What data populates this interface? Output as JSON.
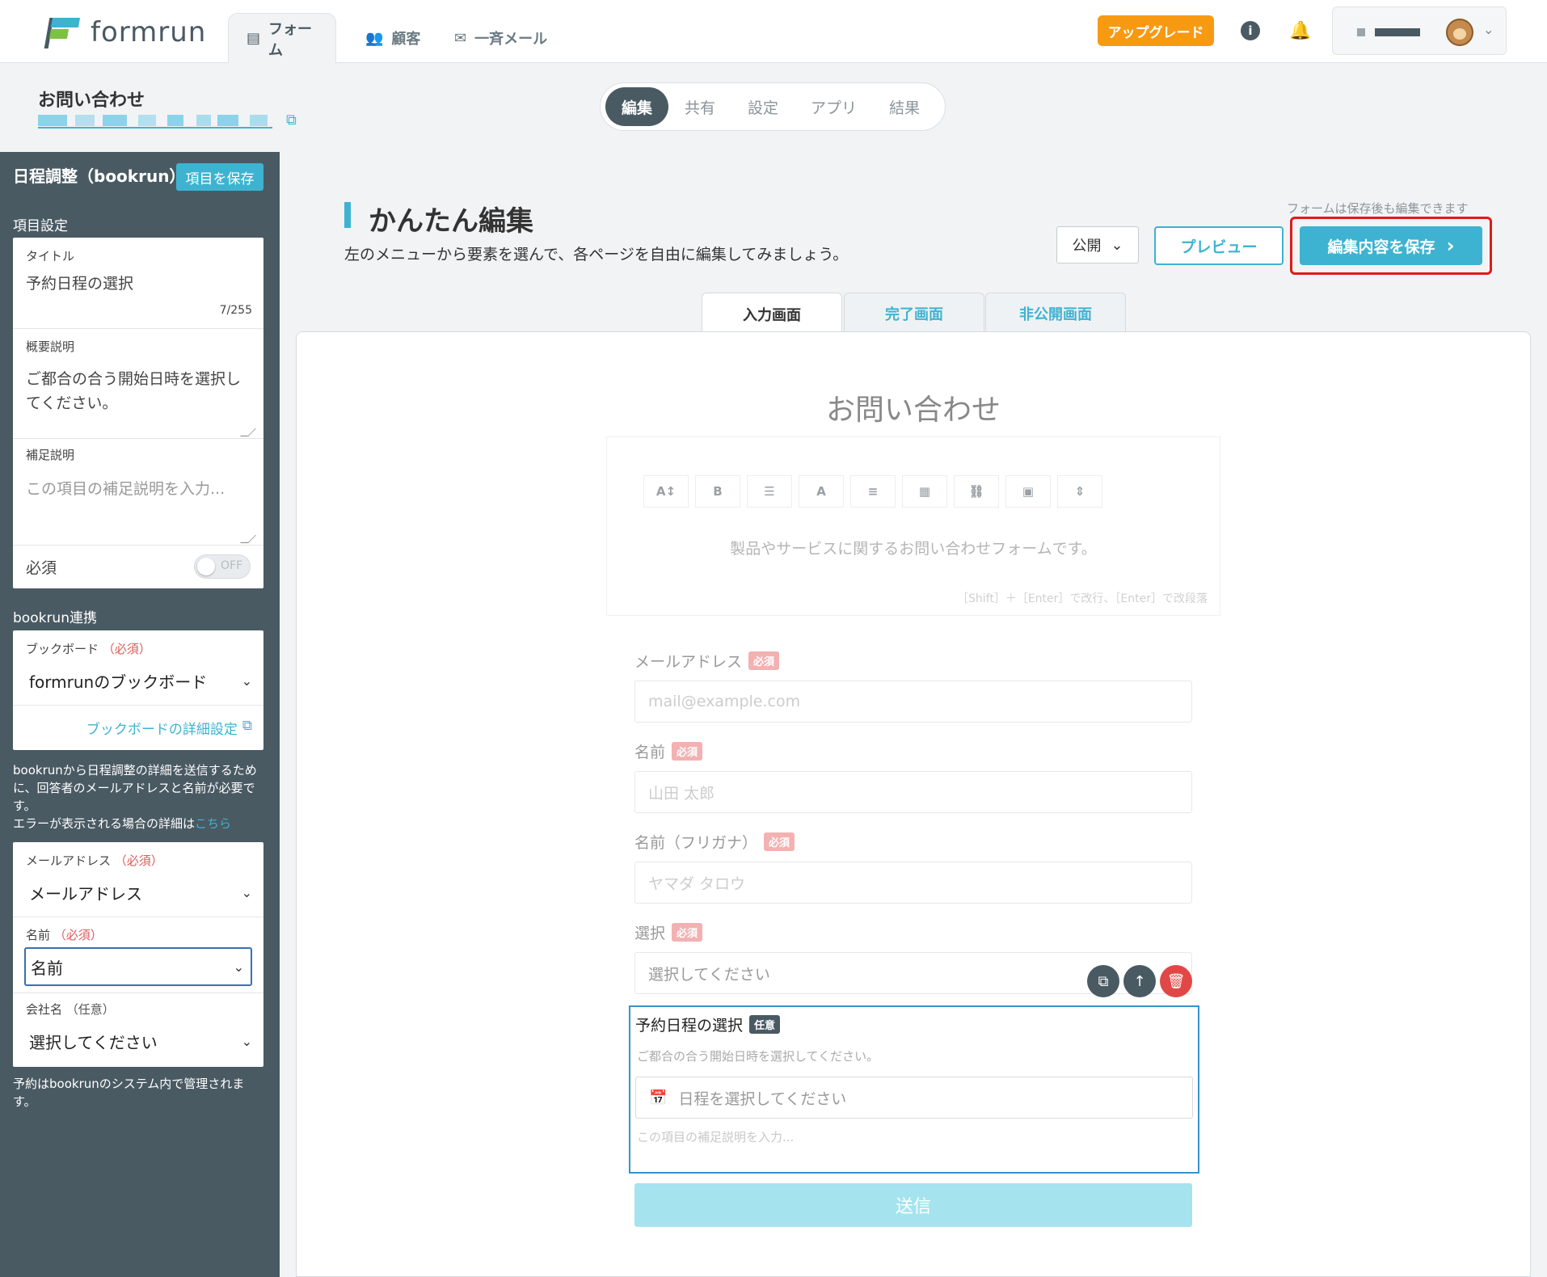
{
  "app": {
    "logo_text": "formrun",
    "nav": [
      {
        "icon": "form-icon",
        "label": "フォーム"
      },
      {
        "icon": "customers-icon",
        "label": "顧客"
      },
      {
        "icon": "mail-icon",
        "label": "一斉メール"
      }
    ],
    "upgrade_label": "アップグレード",
    "info_glyph": "i",
    "bell_glyph": "🔔",
    "account_chevron": "⌄"
  },
  "page": {
    "form_title": "お問い合わせ",
    "external_link_glyph": "⧉",
    "subtabs": [
      "編集",
      "共有",
      "設定",
      "アプリ",
      "結果"
    ]
  },
  "sidebar": {
    "title": "日程調整（bookrun）",
    "save_label": "項目を保存",
    "section_item": "項目設定",
    "title_label": "タイトル",
    "title_value": "予約日程の選択",
    "title_counter": "7/255",
    "summary_label": "概要説明",
    "summary_value": "ご都合の合う開始日時を選択してください。",
    "supplement_label": "補足説明",
    "supplement_placeholder": "この項目の補足説明を入力...",
    "required_label": "必須",
    "required_toggle": "OFF",
    "section_bookrun": "bookrun連携",
    "bookboard_label": "ブックボード",
    "bookboard_req": "（必須）",
    "bookboard_value": "formrunのブックボード",
    "bookboard_link": "ブックボードの詳細設定",
    "note1": "bookrunから日程調整の詳細を送信するために、回答者のメールアドレスと名前が必要です。",
    "note2_prefix": "エラーが表示される場合の詳細は",
    "note2_link": "こちら",
    "email_label": "メールアドレス",
    "email_req": "（必須）",
    "email_value": "メールアドレス",
    "name_label": "名前",
    "name_req": "（必須）",
    "name_value": "名前",
    "company_label": "会社名",
    "company_opt": "（任意）",
    "company_value": "選択してください",
    "footer_note": "予約はbookrunのシステム内で管理されます。",
    "chevron": "⌄"
  },
  "main": {
    "heading": "かんたん編集",
    "subheading": "左のメニューから要素を選んで、各ページを自由に編集してみましょう。",
    "save_hint": "フォームは保存後も編集できます",
    "publish_value": "公開",
    "preview_label": "プレビュー",
    "save_label": "編集内容を保存",
    "save_arrow": "›",
    "screen_tabs": [
      "入力画面",
      "完了画面",
      "非公開画面"
    ]
  },
  "form": {
    "title": "お問い合わせ",
    "toolbar": [
      {
        "icon": "font-size-icon",
        "glyph": "A↕"
      },
      {
        "icon": "bold-icon",
        "glyph": "B"
      },
      {
        "icon": "list-icon",
        "glyph": "☰"
      },
      {
        "icon": "text-color-icon",
        "glyph": "A"
      },
      {
        "icon": "align-icon",
        "glyph": "≡"
      },
      {
        "icon": "table-icon",
        "glyph": "▦"
      },
      {
        "icon": "link-icon",
        "glyph": "⛓"
      },
      {
        "icon": "image-icon",
        "glyph": "▣"
      },
      {
        "icon": "divider-icon",
        "glyph": "⇕"
      }
    ],
    "description": "製品やサービスに関するお問い合わせフォームです。",
    "editor_hint": "［Shift］＋［Enter］で改行、［Enter］で改段落",
    "required_badge": "必須",
    "optional_badge": "任意",
    "fields": [
      {
        "label": "メールアドレス",
        "placeholder": "mail@example.com"
      },
      {
        "label": "名前",
        "placeholder": "山田 太郎"
      },
      {
        "label": "名前（フリガナ）",
        "placeholder": "ヤマダ タロウ"
      },
      {
        "label": "選択",
        "placeholder": "選択してください"
      }
    ],
    "selected_field": {
      "label": "予約日程の選択",
      "description": "ご都合の合う開始日時を選択してください。",
      "placeholder": "日程を選択してください",
      "note": "この項目の補足説明を入力..."
    },
    "actions": {
      "copy": "⧉",
      "up": "↑",
      "delete": "🗑"
    },
    "submit_label": "送信"
  },
  "colors": {
    "accent": "#3eb3d1",
    "sidebar_bg": "#4a5a63",
    "upgrade": "#f79a12",
    "highlight": "#e01a1a"
  }
}
